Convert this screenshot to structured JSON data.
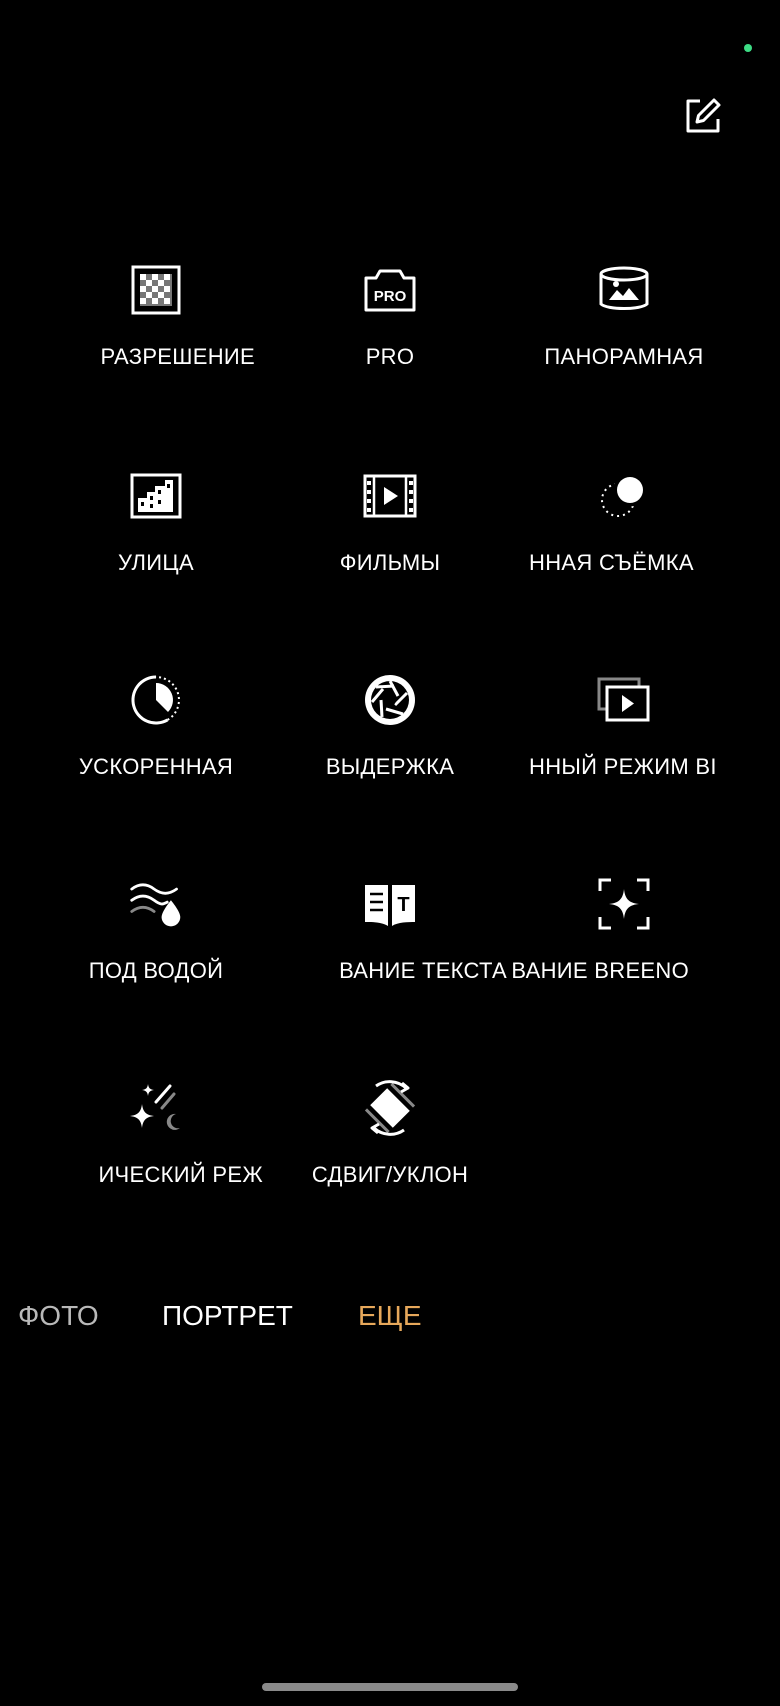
{
  "header": {
    "edit_icon": "edit-icon",
    "status_indicator_color": "#3ddc84"
  },
  "modes": [
    {
      "icon": "high-resolution-icon",
      "label": "РАЗРЕШЕНИЕ"
    },
    {
      "icon": "pro-camera-icon",
      "label": "PRO"
    },
    {
      "icon": "panorama-icon",
      "label": "ПАНОРАМНАЯ"
    },
    {
      "icon": "street-icon",
      "label": "УЛИЦА"
    },
    {
      "icon": "movie-icon",
      "label": "ФИЛЬМЫ"
    },
    {
      "icon": "slow-motion-icon",
      "label": "ННАЯ СЪЁМКА"
    },
    {
      "icon": "time-lapse-icon",
      "label": "УСКОРЕННАЯ"
    },
    {
      "icon": "shutter-icon",
      "label": "ВЫДЕРЖКА"
    },
    {
      "icon": "dual-view-video-icon",
      "label": "ННЫЙ РЕЖИМ ВІ"
    },
    {
      "icon": "underwater-icon",
      "label": "ПОД ВОДОЙ"
    },
    {
      "icon": "text-scanner-icon",
      "label": "ВАНИЕ ТЕКСТА"
    },
    {
      "icon": "breeno-scan-icon",
      "label": "ВАНИЕ BREENO"
    },
    {
      "icon": "starry-night-icon",
      "label": "ИЧЕСКИЙ РЕЖ"
    },
    {
      "icon": "tilt-shift-icon",
      "label": "СДВИГ/УКЛОН"
    }
  ],
  "tabs": [
    {
      "label": "ФОТО",
      "active": false
    },
    {
      "label": "ПОРТРЕТ",
      "active": false
    },
    {
      "label": "ЕЩЕ",
      "active": true
    }
  ],
  "colors": {
    "background": "#000000",
    "text": "#ffffff",
    "active_tab": "#e7a85b"
  }
}
